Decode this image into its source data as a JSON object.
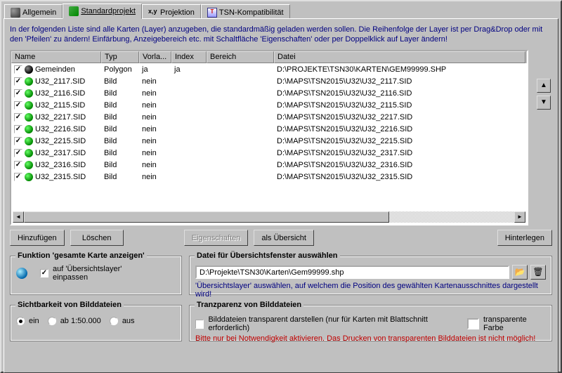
{
  "tabs": [
    {
      "label": "Allgemein",
      "icon": "gears"
    },
    {
      "label": "Standardprojekt",
      "icon": "layers"
    },
    {
      "label": "Projektion",
      "icon": "xy"
    },
    {
      "label": "TSN-Kompatibilität",
      "icon": "ts"
    }
  ],
  "intro": "In der folgenden Liste sind alle Karten (Layer) anzugeben, die standardmäßig geladen werden sollen. Die Reihenfolge der Layer ist per Drag&Drop oder mit den 'Pfeilen' zu ändern! Einfärbung, Anzeigebereich etc. mit Schaltfläche 'Eigenschaften' oder per Doppelklick auf Layer ändern!",
  "columns": {
    "name": "Name",
    "typ": "Typ",
    "vorl": "Vorla...",
    "index": "Index",
    "bereich": "Bereich",
    "datei": "Datei"
  },
  "rows": [
    {
      "name": "Gemeinden",
      "typ": "Polygon",
      "vorl": "ja",
      "index": "ja",
      "bereich": "",
      "datei": "D:\\PROJEKTE\\TSN30\\KARTEN\\GEM99999.SHP",
      "special": true
    },
    {
      "name": "U32_2117.SID",
      "typ": "Bild",
      "vorl": "nein",
      "index": "",
      "bereich": "",
      "datei": "D:\\MAPS\\TSN2015\\U32\\U32_2117.SID"
    },
    {
      "name": "U32_2116.SID",
      "typ": "Bild",
      "vorl": "nein",
      "index": "",
      "bereich": "",
      "datei": "D:\\MAPS\\TSN2015\\U32\\U32_2116.SID"
    },
    {
      "name": "U32_2115.SID",
      "typ": "Bild",
      "vorl": "nein",
      "index": "",
      "bereich": "",
      "datei": "D:\\MAPS\\TSN2015\\U32\\U32_2115.SID"
    },
    {
      "name": "U32_2217.SID",
      "typ": "Bild",
      "vorl": "nein",
      "index": "",
      "bereich": "",
      "datei": "D:\\MAPS\\TSN2015\\U32\\U32_2217.SID"
    },
    {
      "name": "U32_2216.SID",
      "typ": "Bild",
      "vorl": "nein",
      "index": "",
      "bereich": "",
      "datei": "D:\\MAPS\\TSN2015\\U32\\U32_2216.SID"
    },
    {
      "name": "U32_2215.SID",
      "typ": "Bild",
      "vorl": "nein",
      "index": "",
      "bereich": "",
      "datei": "D:\\MAPS\\TSN2015\\U32\\U32_2215.SID"
    },
    {
      "name": "U32_2317.SID",
      "typ": "Bild",
      "vorl": "nein",
      "index": "",
      "bereich": "",
      "datei": "D:\\MAPS\\TSN2015\\U32\\U32_2317.SID"
    },
    {
      "name": "U32_2316.SID",
      "typ": "Bild",
      "vorl": "nein",
      "index": "",
      "bereich": "",
      "datei": "D:\\MAPS\\TSN2015\\U32\\U32_2316.SID"
    },
    {
      "name": "U32_2315.SID",
      "typ": "Bild",
      "vorl": "nein",
      "index": "",
      "bereich": "",
      "datei": "D:\\MAPS\\TSN2015\\U32\\U32_2315.SID"
    }
  ],
  "buttons": {
    "add": "Hinzufügen",
    "delete": "Löschen",
    "props": "Eigenschaften",
    "overview": "als Übersicht",
    "attach": "Hinterlegen"
  },
  "overview_fn": {
    "title": "Funktion 'gesamte Karte anzeigen'",
    "cb_label": "auf 'Übersichtslayer' einpassen"
  },
  "overview_file": {
    "title": "Datei für Übersichtsfenster auswählen",
    "value": "D:\\Projekte\\TSN30\\Karten\\Gem99999.shp",
    "hint": "'Übersichtslayer' auswählen, auf welchem die Position des gewählten Kartenausschnittes dargestellt wird!"
  },
  "visibility": {
    "title": "Sichtbarkeit von Bilddateien",
    "opt_on": "ein",
    "opt_ab": "ab 1:50.000",
    "opt_off": "aus"
  },
  "transparency": {
    "title": "Tranzparenz von Bilddateien",
    "cb_label": "Bilddateien transparent darstellen (nur für Karten mit Blattschnitt erforderlich)",
    "color_label": "transparente Farbe",
    "warn": "Bitte nur bei Notwendigkeit aktivieren. Das Drucken von transparenten Bilddateien ist nicht möglich!"
  }
}
